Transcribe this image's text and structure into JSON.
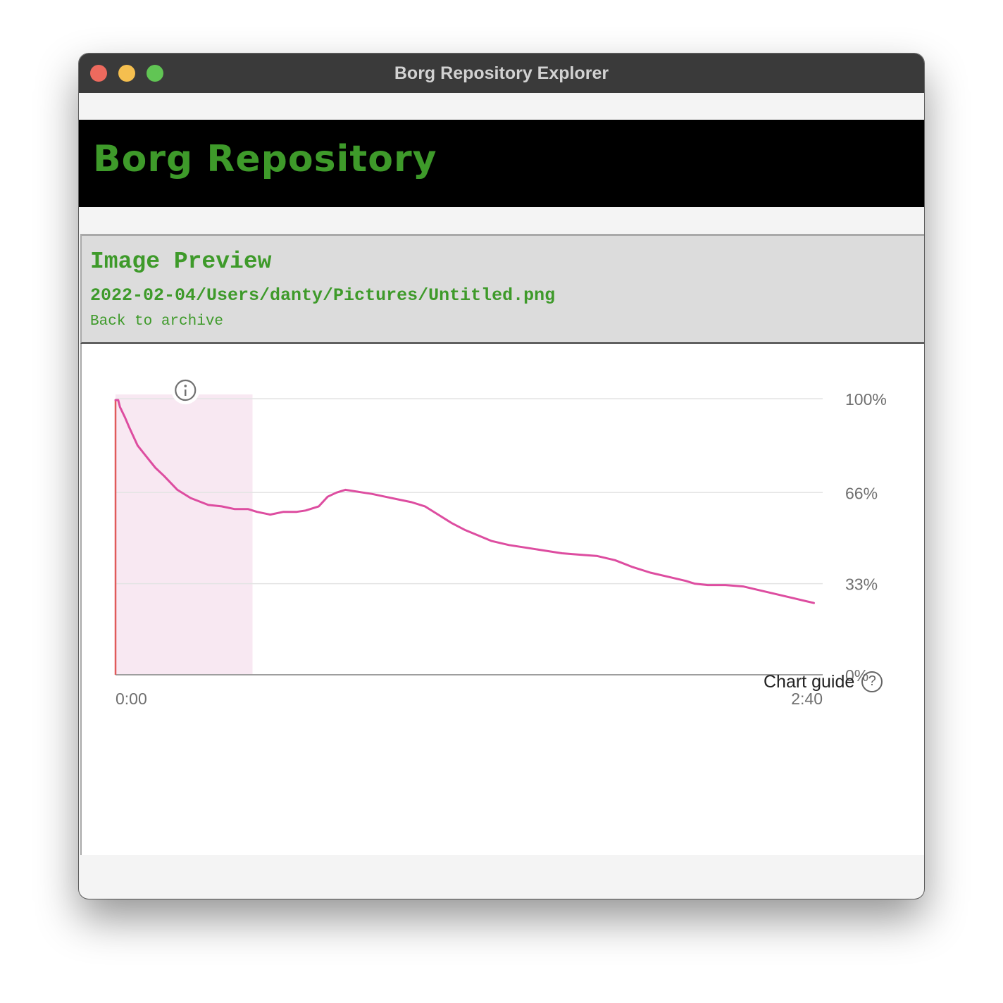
{
  "window": {
    "title": "Borg Repository Explorer"
  },
  "banner": {
    "title": "Borg Repository"
  },
  "preview": {
    "heading": "Image Preview",
    "path": "2022-02-04/Users/danty/Pictures/Untitled.png",
    "back_link": "Back to archive"
  },
  "chart_guide": {
    "label": "Chart guide",
    "icon": "question-circle-icon"
  },
  "chart_data": {
    "type": "line",
    "title": "",
    "xlabel": "",
    "ylabel": "",
    "x_tick_labels": [
      "0:00",
      "2:40"
    ],
    "y_tick_labels": [
      "100%",
      "66%",
      "33%",
      "0%"
    ],
    "y_tick_values": [
      100,
      66,
      33,
      0
    ],
    "xlim": [
      0,
      160
    ],
    "ylim": [
      0,
      100
    ],
    "grid": true,
    "highlight_region": {
      "x_start": 0,
      "x_end": 31,
      "color": "#f8e8f2"
    },
    "start_marker_color": "#e05a5a",
    "info_icon": "info-circle-icon",
    "series": [
      {
        "color": "#dd4da0",
        "x": [
          0,
          0.6,
          1,
          2.2,
          3,
          5,
          7,
          9,
          11,
          14,
          17,
          21,
          24,
          27,
          30,
          32,
          35,
          38,
          41,
          43,
          46,
          48,
          50,
          52,
          54,
          56,
          58,
          61,
          64,
          67,
          70,
          73,
          76,
          79,
          82,
          85,
          89,
          93,
          97,
          101,
          105,
          109,
          113,
          117,
          121,
          125,
          129,
          131,
          134,
          138,
          142,
          146,
          150,
          154,
          158
        ],
        "y": [
          99.5,
          99.5,
          97,
          93,
          90,
          83,
          79,
          75,
          72,
          67,
          64,
          61.5,
          61,
          60,
          60,
          59,
          58,
          59,
          59,
          59.5,
          61,
          64.5,
          66,
          67,
          66.5,
          66,
          65.5,
          64.5,
          63.5,
          62.5,
          61,
          58,
          55,
          52.5,
          50.5,
          48.5,
          47,
          46,
          45,
          44,
          43.5,
          43,
          41.5,
          39,
          37,
          35.5,
          34,
          33,
          32.5,
          32.5,
          32,
          30.5,
          29,
          27.5,
          26
        ]
      }
    ]
  }
}
